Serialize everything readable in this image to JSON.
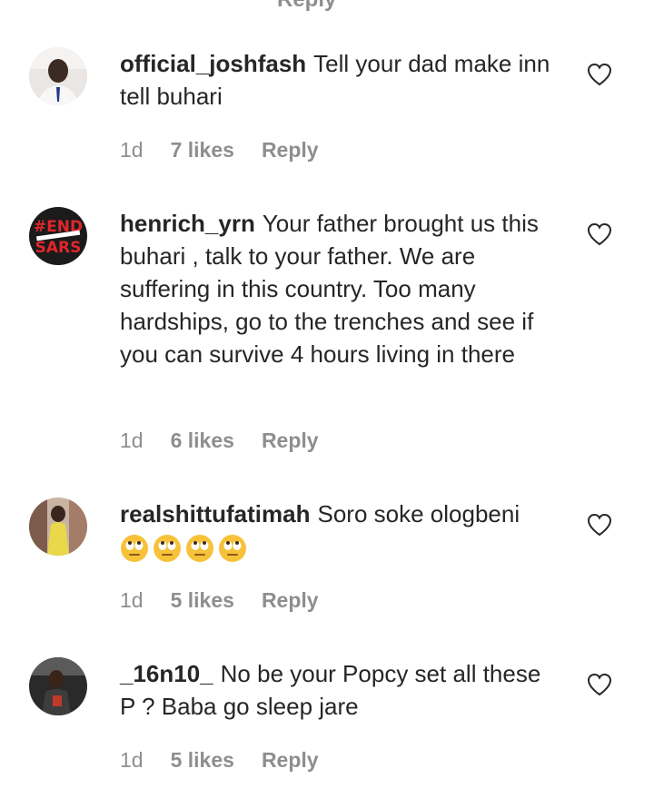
{
  "top_fragment": "Reply",
  "comments": [
    {
      "username": "official_joshfash",
      "text": "Tell your dad make inn tell buhari",
      "time": "1d",
      "likes": "7 likes",
      "reply": "Reply",
      "avatar": "avatar-man-in-white-shirt"
    },
    {
      "username": "henrich_yrn",
      "text": "Your father brought us this buhari , talk to your father. We are suffering in this country. Too many hardships, go to the trenches and see if you can survive 4 hours living in there",
      "time": "1d",
      "likes": "6 likes",
      "reply": "Reply",
      "avatar": "avatar-end-sars",
      "avatar_text_1": "#END",
      "avatar_text_2": "SARS"
    },
    {
      "username": "realshittufatimah",
      "text": "Soro soke ologbeni",
      "emojis": [
        "🙄",
        "🙄",
        "🙄",
        "🙄"
      ],
      "time": "1d",
      "likes": "5 likes",
      "reply": "Reply",
      "avatar": "avatar-woman-in-yellow"
    },
    {
      "username": "_16n10_",
      "text": "No be your Popcy set all these P ? Baba go sleep jare",
      "time": "1d",
      "likes": "5 likes",
      "reply": "Reply",
      "avatar": "avatar-man-dark-photo"
    }
  ],
  "colors": {
    "text": "#262626",
    "meta": "#8e8e8e",
    "heart_stroke": "#262626"
  },
  "icons": {
    "like": "heart-outline-icon"
  }
}
